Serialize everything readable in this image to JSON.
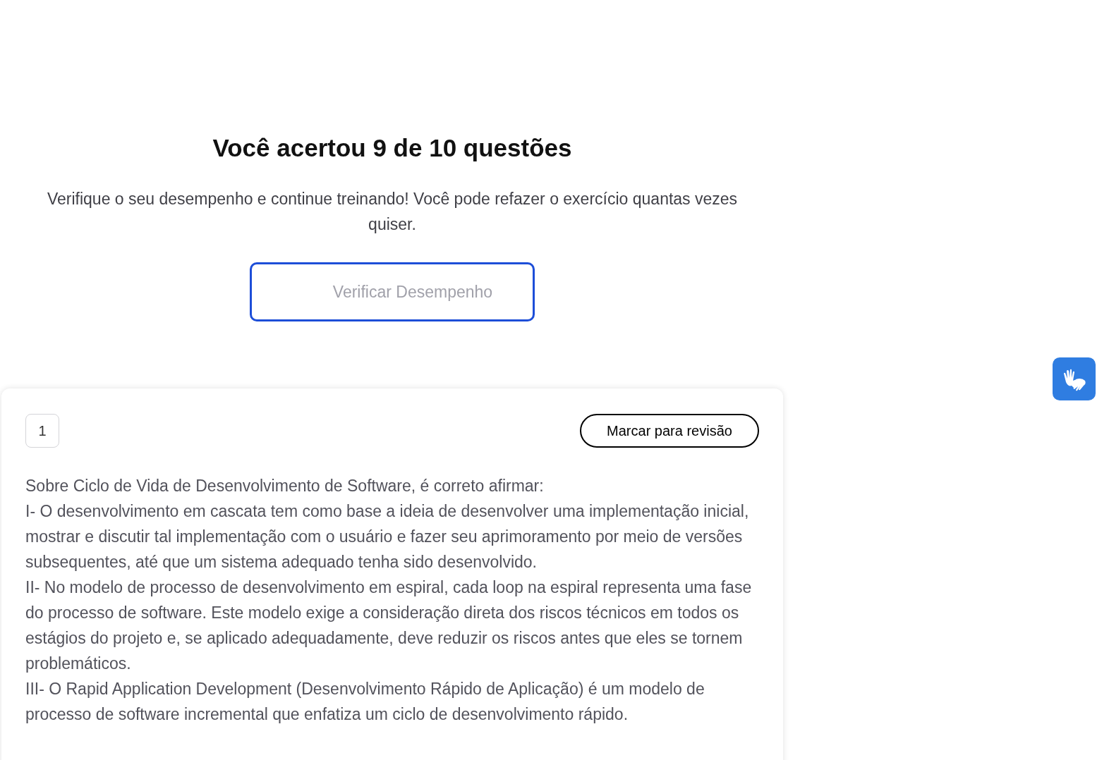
{
  "result": {
    "title": "Você acertou 9 de 10 questões",
    "subtitle": "Verifique o seu desempenho e continue treinando! Você pode refazer o exercício quantas vezes quiser.",
    "button": {
      "label": "Verificar Desempenho",
      "disabled": true
    }
  },
  "question": {
    "number": "1",
    "review_button": "Marcar para revisão",
    "paragraphs": [
      "Sobre Ciclo de Vida de Desenvolvimento de Software, é correto afirmar:",
      "I- O desenvolvimento em cascata tem como base a ideia de desenvolver uma implementação inicial, mostrar e discutir tal implementação com o usuário e fazer seu aprimoramento por meio de versões subsequentes, até que um sistema adequado tenha sido desenvolvido.",
      "II- No modelo de processo de desenvolvimento em espiral, cada loop na espiral representa uma fase do processo de software. Este modelo exige a consideração direta dos riscos técnicos em todos os estágios do projeto e, se aplicado adequadamente, deve reduzir os riscos antes que eles se tornem problemáticos.",
      "III- O Rapid Application Development (Desenvolvimento Rápido de Aplicação) é um modelo de processo de software incremental que enfatiza um ciclo de desenvolvimento rápido."
    ]
  }
}
